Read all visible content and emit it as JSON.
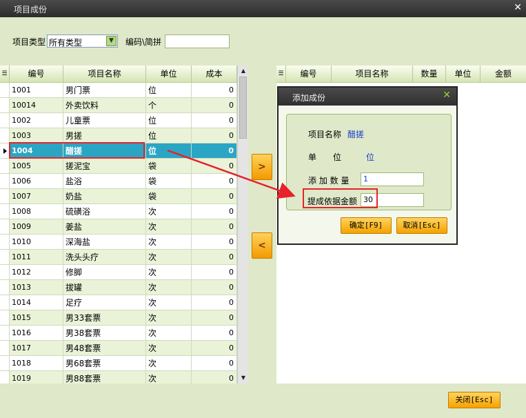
{
  "window": {
    "title": "项目成份",
    "close_glyph": "✕"
  },
  "filter": {
    "type_label": "项目类型",
    "type_value": "所有类型",
    "code_label": "编码\\简拼",
    "code_value": ""
  },
  "left_table": {
    "headers": [
      "编号",
      "项目名称",
      "单位",
      "成本"
    ],
    "rows": [
      {
        "code": "1001",
        "name": "男门票",
        "unit": "位",
        "cost": "0"
      },
      {
        "code": "10014",
        "name": "外卖饮料",
        "unit": "个",
        "cost": "0"
      },
      {
        "code": "1002",
        "name": "儿童票",
        "unit": "位",
        "cost": "0"
      },
      {
        "code": "1003",
        "name": "男搓",
        "unit": "位",
        "cost": "0"
      },
      {
        "code": "1004",
        "name": "醋搓",
        "unit": "位",
        "cost": "0"
      },
      {
        "code": "1005",
        "name": "搓泥宝",
        "unit": "袋",
        "cost": "0"
      },
      {
        "code": "1006",
        "name": "盐浴",
        "unit": "袋",
        "cost": "0"
      },
      {
        "code": "1007",
        "name": "奶盐",
        "unit": "袋",
        "cost": "0"
      },
      {
        "code": "1008",
        "name": "硫磺浴",
        "unit": "次",
        "cost": "0"
      },
      {
        "code": "1009",
        "name": "姜盐",
        "unit": "次",
        "cost": "0"
      },
      {
        "code": "1010",
        "name": "深海盐",
        "unit": "次",
        "cost": "0"
      },
      {
        "code": "1011",
        "name": "洗头头疗",
        "unit": "次",
        "cost": "0"
      },
      {
        "code": "1012",
        "name": "修脚",
        "unit": "次",
        "cost": "0"
      },
      {
        "code": "1013",
        "name": "拔罐",
        "unit": "次",
        "cost": "0"
      },
      {
        "code": "1014",
        "name": "足疗",
        "unit": "次",
        "cost": "0"
      },
      {
        "code": "1015",
        "name": "男33套票",
        "unit": "次",
        "cost": "0"
      },
      {
        "code": "1016",
        "name": "男38套票",
        "unit": "次",
        "cost": "0"
      },
      {
        "code": "1017",
        "name": "男48套票",
        "unit": "次",
        "cost": "0"
      },
      {
        "code": "1018",
        "name": "男68套票",
        "unit": "次",
        "cost": "0"
      },
      {
        "code": "1019",
        "name": "男88套票",
        "unit": "次",
        "cost": "0"
      }
    ],
    "selected_index": 4
  },
  "right_table": {
    "headers": [
      "编号",
      "项目名称",
      "数量",
      "单位",
      "金额"
    ]
  },
  "move_buttons": {
    "add": ">",
    "remove": "<"
  },
  "dialog": {
    "title": "添加成份",
    "close_glyph": "✕",
    "name_label": "项目名称",
    "name_value": "醋搓",
    "unit_label": "单　　位",
    "unit_value": "位",
    "qty_label": "添 加 数 量",
    "qty_value": "1",
    "basis_label": "提成依据金额",
    "basis_value": "30",
    "ok_label": "确定[F9]",
    "cancel_label": "取消[Esc]"
  },
  "footer": {
    "close_label": "关闭[Esc]"
  },
  "colors": {
    "highlight_red": "#e8212a",
    "selected_row": "#2aa6c4",
    "button_orange": "#f5a200",
    "background": "#dfe8c8"
  },
  "icons": {
    "menu_grid": "grid-menu-icon",
    "scroll_up": "up-arrow-icon",
    "scroll_down": "down-arrow-icon",
    "dropdown": "chevron-down-icon"
  }
}
